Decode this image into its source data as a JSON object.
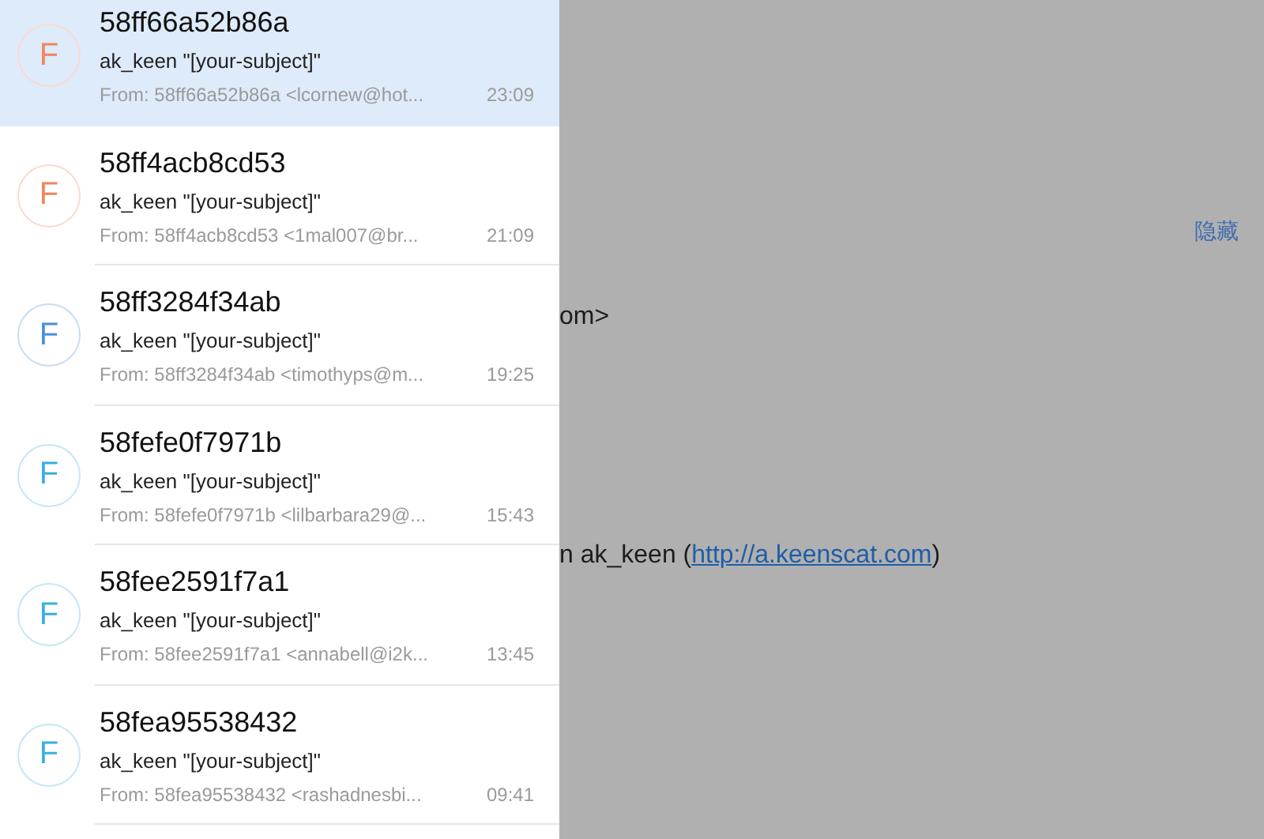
{
  "detail": {
    "hide_link": "隐藏",
    "sender_fragment": "om>",
    "footer_text": "n ak_keen (",
    "footer_link": "http://a.keenscat.com",
    "footer_end": ")"
  },
  "messages": [
    {
      "avatar": "F",
      "color": "#f0855f",
      "title": "58ff66a52b86a",
      "subject": "ak_keen \"[your-subject]\"",
      "from": "From: 58ff66a52b86a <lcornew@hot...",
      "time": "23:09",
      "selected": true
    },
    {
      "avatar": "F",
      "color": "#f0855f",
      "title": "58ff4acb8cd53",
      "subject": "ak_keen \"[your-subject]\"",
      "from": "From: 58ff4acb8cd53 <1mal007@br...",
      "time": "21:09",
      "selected": false
    },
    {
      "avatar": "F",
      "color": "#4a8fd8",
      "title": "58ff3284f34ab",
      "subject": "ak_keen \"[your-subject]\"",
      "from": "From: 58ff3284f34ab <timothyps@m...",
      "time": "19:25",
      "selected": false
    },
    {
      "avatar": "F",
      "color": "#3aaee0",
      "title": "58fefe0f7971b",
      "subject": "ak_keen \"[your-subject]\"",
      "from": "From: 58fefe0f7971b <lilbarbara29@...",
      "time": "15:43",
      "selected": false
    },
    {
      "avatar": "F",
      "color": "#3aaee0",
      "title": "58fee2591f7a1",
      "subject": "ak_keen \"[your-subject]\"",
      "from": "From: 58fee2591f7a1 <annabell@i2k...",
      "time": "13:45",
      "selected": false
    },
    {
      "avatar": "F",
      "color": "#3aaee0",
      "title": "58fea95538432",
      "subject": "ak_keen \"[your-subject]\"",
      "from": "From: 58fea95538432 <rashadnesbi...",
      "time": "09:41",
      "selected": false
    }
  ]
}
